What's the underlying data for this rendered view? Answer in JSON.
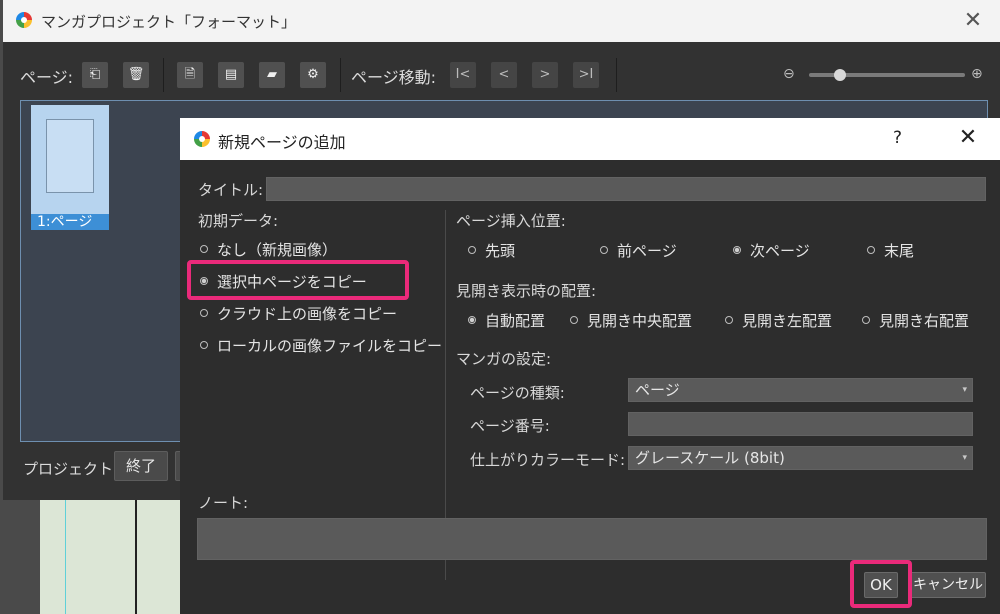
{
  "outer_window": {
    "title": "マンガプロジェクト「フォーマット」",
    "close_glyph": "✕"
  },
  "toolbar": {
    "page_label": "ページ:",
    "page_move_label": "ページ移動:",
    "buttons": [
      {
        "icon": "add-page-icon",
        "glyph": "⎗"
      },
      {
        "icon": "trash-icon",
        "glyph": "🗑"
      },
      {
        "icon": "page-properties-icon",
        "glyph": "🗎"
      },
      {
        "icon": "page-settings-icon",
        "glyph": "▤"
      },
      {
        "icon": "open-folder-icon",
        "glyph": "▰"
      },
      {
        "icon": "folder-settings-icon",
        "glyph": "⚙"
      }
    ],
    "nav_buttons": [
      {
        "icon": "first-page-icon",
        "glyph": "I<"
      },
      {
        "icon": "prev-page-icon",
        "glyph": "<"
      },
      {
        "icon": "next-page-icon",
        "glyph": ">"
      },
      {
        "icon": "last-page-icon",
        "glyph": ">I"
      }
    ],
    "zoom_out_glyph": "⊖",
    "zoom_in_glyph": "⊕",
    "zoom_level": 0.2
  },
  "pages": [
    {
      "label": "1:ページ"
    }
  ],
  "project": {
    "label": "プロジェクト:",
    "close_button": "終了"
  },
  "dialog": {
    "title": "新規ページの追加",
    "help_glyph": "?",
    "close_glyph": "✕",
    "title_field_label": "タイトル:",
    "title_value": "",
    "initial_data": {
      "label": "初期データ:",
      "options": [
        {
          "label": "なし（新規画像）",
          "selected": false
        },
        {
          "label": "選択中ページをコピー",
          "selected": true
        },
        {
          "label": "クラウド上の画像をコピー",
          "selected": false
        },
        {
          "label": "ローカルの画像ファイルをコピー",
          "selected": false
        }
      ]
    },
    "insert_position": {
      "label": "ページ挿入位置:",
      "options": [
        {
          "label": "先頭",
          "selected": false
        },
        {
          "label": "前ページ",
          "selected": false
        },
        {
          "label": "次ページ",
          "selected": true
        },
        {
          "label": "末尾",
          "selected": false
        }
      ]
    },
    "spread_layout": {
      "label": "見開き表示時の配置:",
      "options": [
        {
          "label": "自動配置",
          "selected": true
        },
        {
          "label": "見開き中央配置",
          "selected": false
        },
        {
          "label": "見開き左配置",
          "selected": false
        },
        {
          "label": "見開き右配置",
          "selected": false
        }
      ]
    },
    "manga_settings": {
      "label": "マンガの設定:",
      "page_type_label": "ページの種類:",
      "page_type_value": "ページ",
      "page_number_label": "ページ番号:",
      "page_number_value": "",
      "color_mode_label": "仕上がりカラーモード:",
      "color_mode_value": "グレースケール (8bit)"
    },
    "note_label": "ノート:",
    "note_value": "",
    "ok_button": "OK",
    "cancel_button": "キャンセル"
  },
  "colors": {
    "highlight": "#ea2a7a",
    "dialog_bg": "#2d2d2d",
    "selected_page": "#3d8fd6"
  }
}
